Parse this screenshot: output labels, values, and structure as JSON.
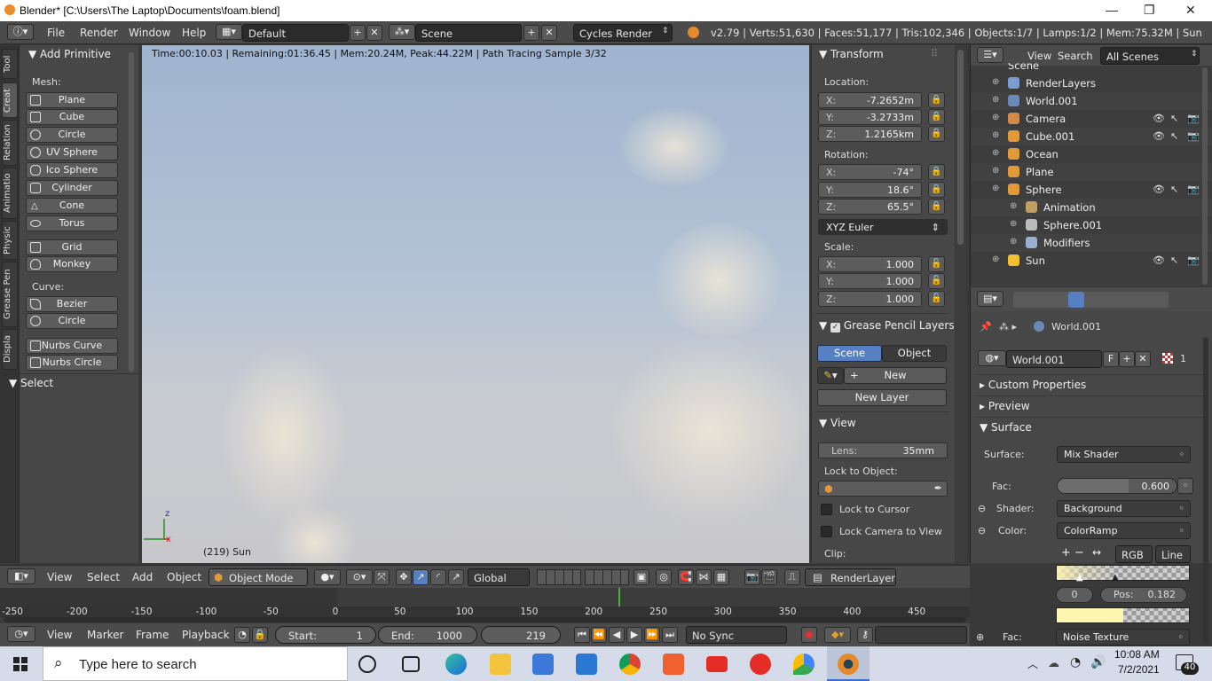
{
  "window": {
    "title": "Blender* [C:\\Users\\The Laptop\\Documents\\foam.blend]"
  },
  "topbar": {
    "menus": [
      "File",
      "Render",
      "Window",
      "Help"
    ],
    "layout": "Default",
    "scene": "Scene",
    "engine": "Cycles Render",
    "stats": "v2.79 | Verts:51,630 | Faces:51,177 | Tris:102,346 | Objects:1/7 | Lamps:1/2 | Mem:75.32M | Sun"
  },
  "tabs": [
    "Tool",
    "Creat",
    "Relation",
    "Animatio",
    "Physic",
    "Grease Pen",
    "Displa"
  ],
  "toolshelf": {
    "title": "Add Primitive",
    "mesh_label": "Mesh:",
    "mesh": [
      "Plane",
      "Cube",
      "Circle",
      "UV Sphere",
      "Ico Sphere",
      "Cylinder",
      "Cone",
      "Torus"
    ],
    "mesh2": [
      "Grid",
      "Monkey"
    ],
    "curve_label": "Curve:",
    "curve": [
      "Bezier",
      "Circle"
    ],
    "nurbs": [
      "Nurbs Curve",
      "Nurbs Circle"
    ],
    "select_title": "Select"
  },
  "viewport": {
    "info": "Time:00:10.03 | Remaining:01:36.45 | Mem:20.24M, Peak:44.22M | Path Tracing Sample 3/32",
    "object": "(219) Sun",
    "axis_z": "z",
    "axis_x": "x"
  },
  "npanel": {
    "transform_title": "Transform",
    "location_label": "Location:",
    "location": [
      {
        "k": "X:",
        "v": "-7.2652m"
      },
      {
        "k": "Y:",
        "v": "-3.2733m"
      },
      {
        "k": "Z:",
        "v": "1.2165km"
      }
    ],
    "rotation_label": "Rotation:",
    "rotation": [
      {
        "k": "X:",
        "v": "-74°"
      },
      {
        "k": "Y:",
        "v": "18.6°"
      },
      {
        "k": "Z:",
        "v": "65.5°"
      }
    ],
    "rotation_mode": "XYZ Euler",
    "scale_label": "Scale:",
    "scale": [
      {
        "k": "X:",
        "v": "1.000"
      },
      {
        "k": "Y:",
        "v": "1.000"
      },
      {
        "k": "Z:",
        "v": "1.000"
      }
    ],
    "gp_title": "Grease Pencil Layers",
    "gp_scene": "Scene",
    "gp_object": "Object",
    "gp_new": "New",
    "gp_new_layer": "New Layer",
    "view_title": "View",
    "lens_k": "Lens:",
    "lens_v": "35mm",
    "lock_to_object": "Lock to Object:",
    "lock_cursor": "Lock to Cursor",
    "lock_camera": "Lock Camera to View",
    "clip": "Clip:"
  },
  "outliner": {
    "menus": [
      "View",
      "Search"
    ],
    "filter": "All Scenes",
    "rows": [
      {
        "name": "RenderLayers",
        "indent": 1
      },
      {
        "name": "World.001",
        "indent": 1
      },
      {
        "name": "Camera",
        "indent": 1
      },
      {
        "name": "Cube.001",
        "indent": 1
      },
      {
        "name": "Ocean",
        "indent": 1
      },
      {
        "name": "Plane",
        "indent": 1
      },
      {
        "name": "Sphere",
        "indent": 1
      },
      {
        "name": "Animation",
        "indent": 2
      },
      {
        "name": "Sphere.001",
        "indent": 2
      },
      {
        "name": "Modifiers",
        "indent": 2
      },
      {
        "name": "Sun",
        "indent": 1
      }
    ],
    "top_partial": "Scene"
  },
  "props": {
    "breadcrumb": "World.001",
    "world_name": "World.001",
    "fake_user": "F",
    "users": "1",
    "custom_props": "Custom Properties",
    "preview": "Preview",
    "surface_title": "Surface",
    "surface_label": "Surface:",
    "surface_value": "Mix Shader",
    "fac_label": "Fac:",
    "fac_value": "0.600",
    "fac_fraction": 0.6,
    "shader_label": "Shader:",
    "shader_value": "Background",
    "color_label": "Color:",
    "color_value": "ColorRamp",
    "ramp_mode": "RGB",
    "ramp_interp": "Line",
    "ramp_index": "0",
    "ramp_pos_k": "Pos:",
    "ramp_pos_v": "0.182",
    "fac2_label": "Fac:",
    "fac2_value": "Noise Texture",
    "ramp_color": "#fff6b0"
  },
  "view3d_header": {
    "menus": [
      "View",
      "Select",
      "Add",
      "Object"
    ],
    "mode": "Object Mode",
    "orientation": "Global",
    "render_layer": "RenderLayer"
  },
  "timeline": {
    "ticks": [
      "-250",
      "-200",
      "-150",
      "-100",
      "-50",
      "0",
      "50",
      "100",
      "150",
      "200",
      "250",
      "300",
      "350",
      "400",
      "450"
    ],
    "current_frame": 219,
    "menus": [
      "View",
      "Marker",
      "Frame",
      "Playback"
    ],
    "start_k": "Start:",
    "start_v": "1",
    "end_k": "End:",
    "end_v": "1000",
    "frame": "219",
    "sync": "No Sync"
  },
  "taskbar": {
    "search_placeholder": "Type here to search",
    "time": "10:08 AM",
    "date": "7/2/2021",
    "notif": "40"
  }
}
